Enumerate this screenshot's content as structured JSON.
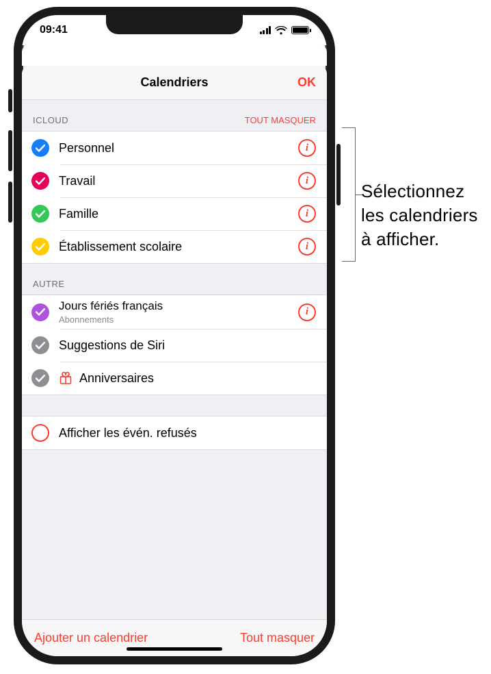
{
  "statusbar": {
    "time": "09:41"
  },
  "sheet": {
    "title": "Calendriers",
    "ok": "OK"
  },
  "groups": {
    "icloud": {
      "header": "ICLOUD",
      "hide_all": "TOUT MASQUER",
      "items": [
        {
          "label": "Personnel",
          "color": "#157efb",
          "checked": true,
          "info": true
        },
        {
          "label": "Travail",
          "color": "#e6005c",
          "checked": true,
          "info": true
        },
        {
          "label": "Famille",
          "color": "#34c759",
          "checked": true,
          "info": true
        },
        {
          "label": "Établissement scolaire",
          "color": "#ffcc00",
          "checked": true,
          "info": true
        }
      ]
    },
    "other": {
      "header": "AUTRE",
      "items": [
        {
          "label": "Jours fériés français",
          "sublabel": "Abonnements",
          "color": "#af52de",
          "checked": true,
          "info": true
        },
        {
          "label": "Suggestions de Siri",
          "color": "#8e8e93",
          "checked": true,
          "info": false
        },
        {
          "label": "Anniversaires",
          "color": "#8e8e93",
          "checked": true,
          "info": false,
          "gift": true
        }
      ]
    },
    "declined": {
      "label": "Afficher les évén. refusés"
    }
  },
  "toolbar": {
    "add": "Ajouter un calendrier",
    "hide_all": "Tout masquer"
  },
  "callout": {
    "line1": "Sélectionnez",
    "line2": "les calendriers",
    "line3": "à afficher."
  }
}
